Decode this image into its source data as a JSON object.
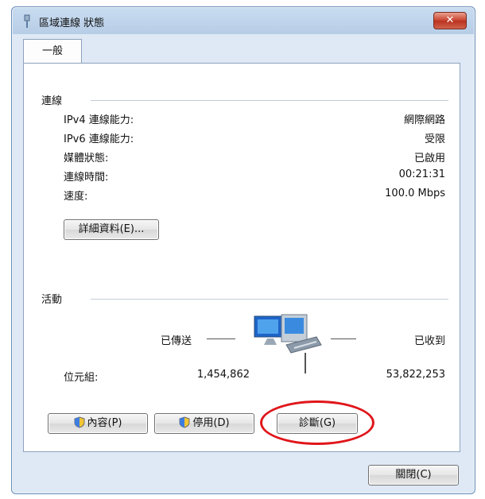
{
  "window": {
    "title": "區域連線 狀態"
  },
  "tabs": [
    {
      "label": "一般"
    }
  ],
  "connection": {
    "section_label": "連線",
    "rows": [
      {
        "label": "IPv4 連線能力:",
        "value": "網際網路"
      },
      {
        "label": "IPv6 連線能力:",
        "value": "受限"
      },
      {
        "label": "媒體狀態:",
        "value": "已啟用"
      },
      {
        "label": "連線時間:",
        "value": "00:21:31"
      },
      {
        "label": "速度:",
        "value": "100.0 Mbps"
      }
    ],
    "details_button": "詳細資料(E)..."
  },
  "activity": {
    "section_label": "活動",
    "sent_label": "已傳送",
    "received_label": "已收到",
    "bytes_label": "位元組:",
    "bytes_sent": "1,454,862",
    "bytes_received": "53,822,253",
    "network_icon": "network-computers-icon"
  },
  "actions": {
    "properties": "內容(P)",
    "disable": "停用(D)",
    "diagnose": "診斷(G)",
    "close": "關閉(C)"
  },
  "colors": {
    "highlight_ring": "#e0161a",
    "close_button": "#c8412c"
  }
}
